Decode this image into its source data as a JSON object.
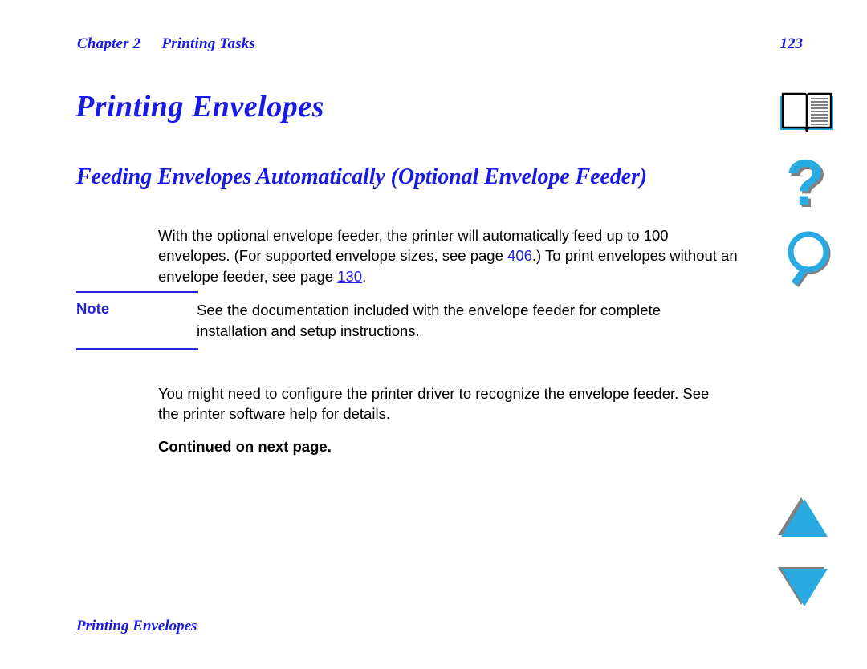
{
  "header": {
    "chapter_label": "Chapter 2",
    "chapter_title": "Printing Tasks",
    "page_number": "123"
  },
  "title": "Printing Envelopes",
  "subtitle": "Feeding Envelopes Automatically (Optional Envelope Feeder)",
  "body": {
    "intro_part1": "With the optional envelope feeder, the printer will automatically feed up to 100 envelopes. (For supported envelope sizes, see page ",
    "intro_link1": "406",
    "intro_part2": ".) To print envelopes without an envelope feeder, see page ",
    "intro_link2": "130",
    "intro_part3": ".",
    "driver_paragraph": "You might need to configure the printer driver to recognize the envelope feeder. See the printer software help for details.",
    "continued": "Continued on next page."
  },
  "note": {
    "label": "Note",
    "text": "See the documentation included with the envelope feeder for complete installation and setup instructions."
  },
  "footer": {
    "text": "Printing Envelopes"
  },
  "nav_icons": [
    {
      "name": "book-icon",
      "title": "Table of contents"
    },
    {
      "name": "question-mark-icon",
      "title": "Help"
    },
    {
      "name": "magnifier-icon",
      "title": "Search"
    },
    {
      "name": "triangle-up-icon",
      "title": "Previous page"
    },
    {
      "name": "triangle-down-icon",
      "title": "Next page"
    }
  ],
  "colors": {
    "heading_blue": "#1a1ae6",
    "link_blue": "#2323e0",
    "icon_cyan": "#29 abe2",
    "icon_shadow": "#808080",
    "text_black": "#000000"
  }
}
